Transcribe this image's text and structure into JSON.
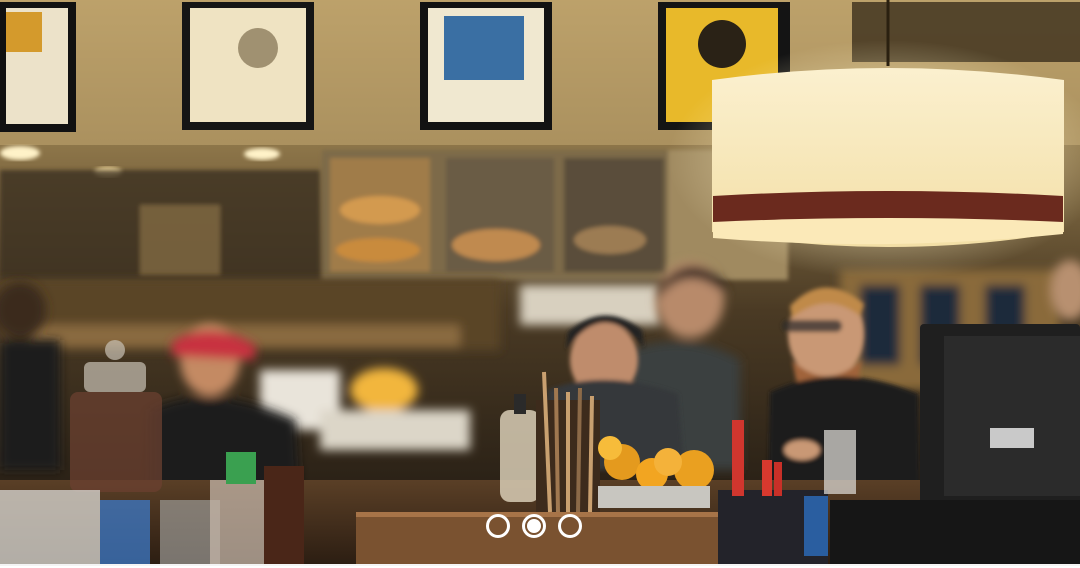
{
  "carousel": {
    "slide_count": 3,
    "active_index": 1,
    "image_subject": "cafe-interior-photo",
    "colors": {
      "dot_border": "#ffffff",
      "dot_active_fill": "#ffffff"
    }
  }
}
